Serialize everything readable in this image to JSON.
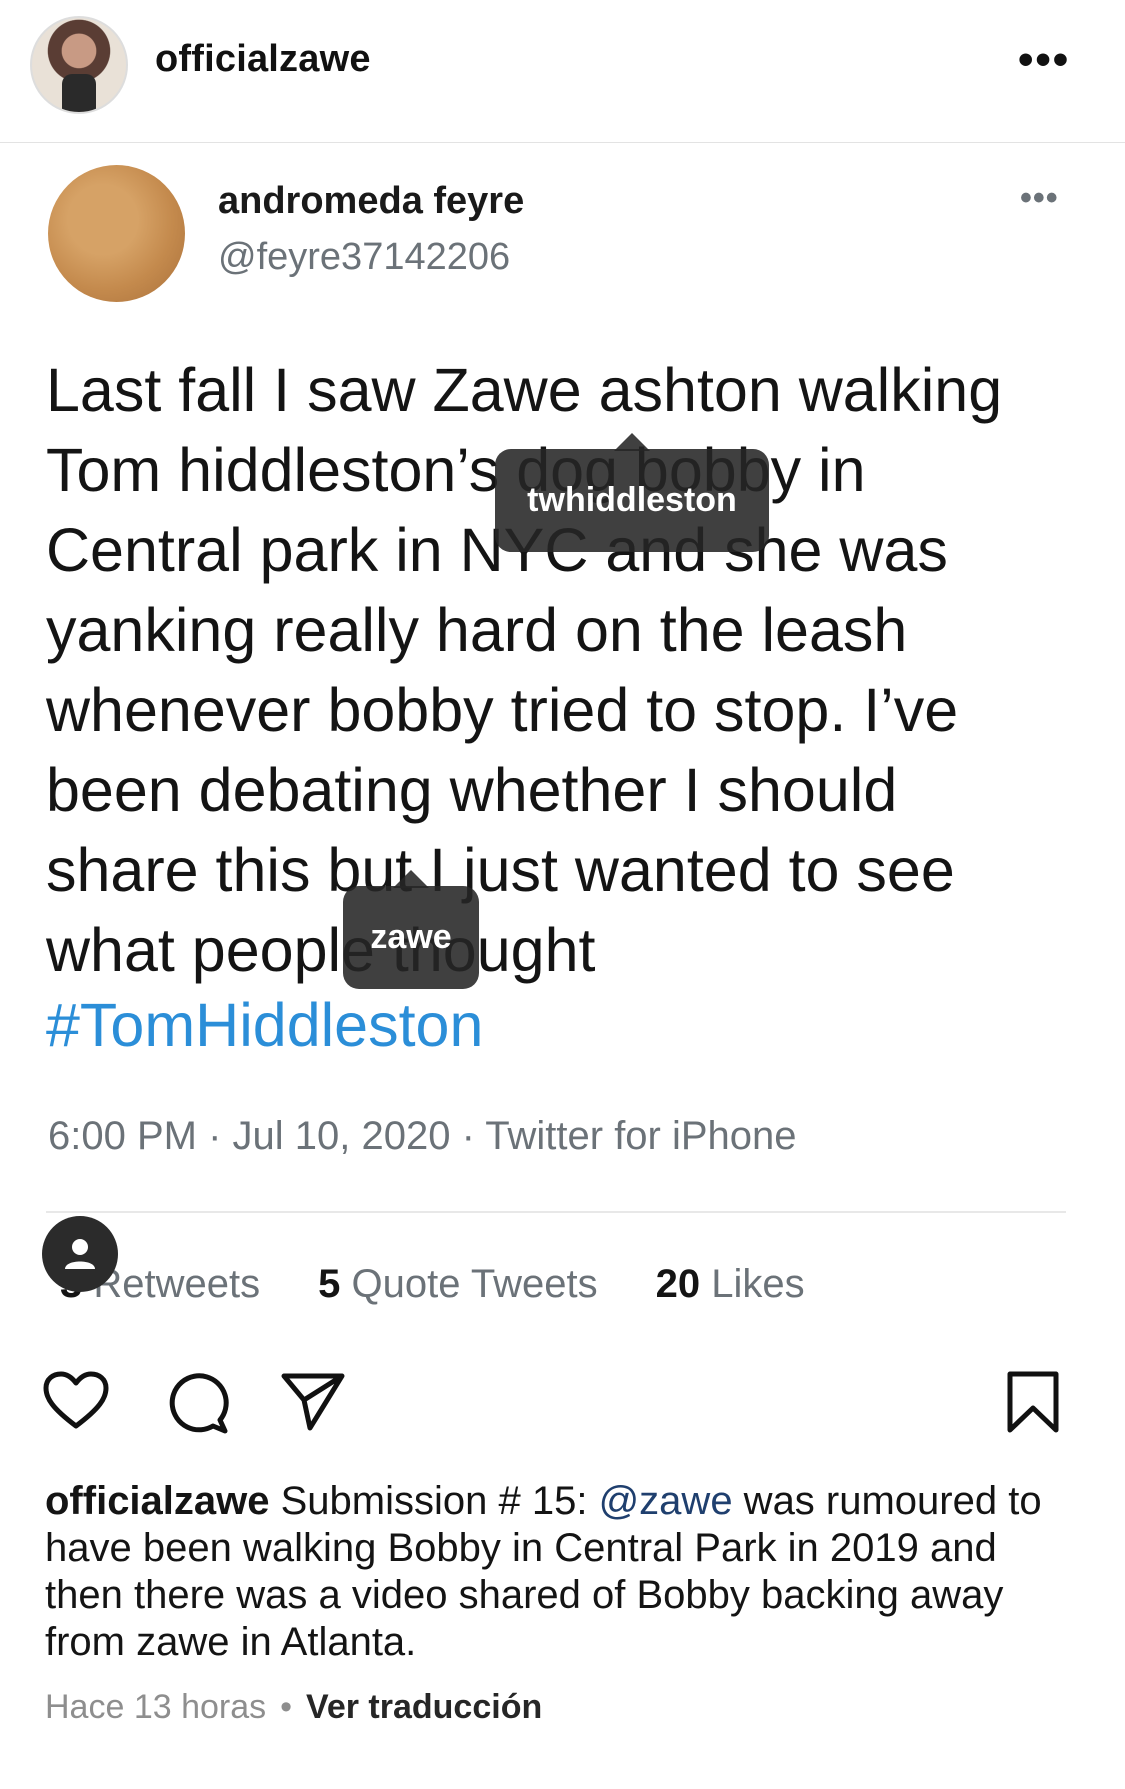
{
  "post": {
    "username": "officialzawe",
    "more_label": "•••"
  },
  "tweet": {
    "name": "andromeda feyre",
    "handle": "@feyre37142206",
    "more_label": "•••",
    "text": "Last fall I saw Zawe ashton walking\nTom hiddleston’s dog bobby in\nCentral park in NYC and she was\nyanking really hard on the leash\nwhenever bobby tried to stop. I’ve\nbeen debating whether I should\nshare this but I just wanted to see\nwhat people thought",
    "hashtag": "#TomHiddleston",
    "meta": "6:00 PM · Jul 10, 2020 · Twitter for iPhone",
    "retweets_count": "3",
    "retweets_label": "Retweets",
    "quotes_count": "5",
    "quotes_label": "Quote Tweets",
    "likes_count": "20",
    "likes_label": "Likes"
  },
  "tags": [
    {
      "name": "twhiddleston"
    },
    {
      "name": "zawe"
    }
  ],
  "caption": {
    "username": "officialzawe",
    "text_before": " Submission # 15: ",
    "mention": "@zawe",
    "text_after": " was rumoured to have been walking Bobby in Central Park in 2019 and then there was a video shared of Bobby backing away from zawe in Atlanta."
  },
  "footer": {
    "time": "Hace 13 horas",
    "separator": "•",
    "translate": "Ver traducción"
  },
  "icons": [
    "more-icon",
    "user-tag-icon",
    "heart-icon",
    "comment-icon",
    "share-icon",
    "bookmark-icon"
  ]
}
